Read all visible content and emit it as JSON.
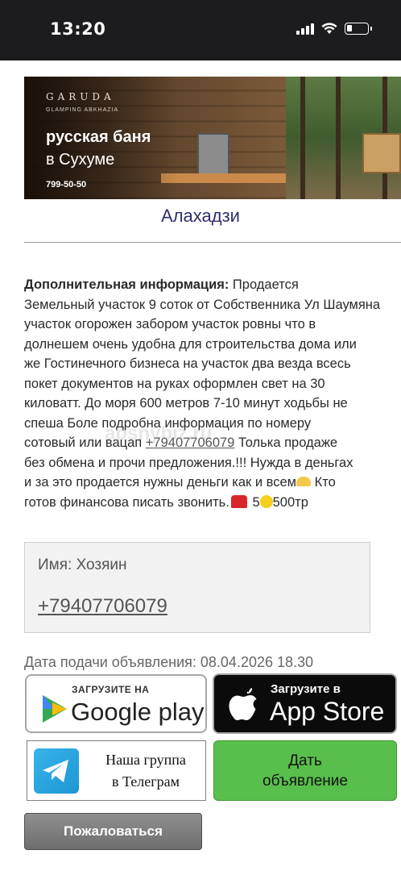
{
  "status_bar": {
    "time": "13:20"
  },
  "banner": {
    "logo": "GARUDA",
    "subtitle": "GLAMPING ABKHAZIA",
    "title_line1": "русская баня",
    "title_line2": "в Сухуме",
    "phone": "799-50-50"
  },
  "listing": {
    "city": "Алахадзи",
    "description_label": "Дополнительная информация:",
    "description_part1": " Продается\nЗемельный участок 9 соток от Собственника Ул Шаумяна\nучасток огорожен забором  участок ровны что в\nдолнешем  очень удобна для строительства дома или\nже  Гостинечного бизнеса на участок два везда всесь\nпокет документов на руках оформлен свет на 30\nкиловатт. До моря 600 метров 7-10 минут ходьбы не\nспеша Боле подробна  информация по номеру\nсотовый или вацап ",
    "description_phone": "+79407706079",
    "description_part2": "  Толька продаже\nбез обмена и прочи предложения.!!!  Нужда в деньгах\nи за это продается  нужны деньги как и всем",
    "description_part3": " Кто\nготов финансова писать звонить.",
    "description_price_a": " 5",
    "description_price_b": "500тр",
    "watermark": "apsnybiz.ru"
  },
  "contact": {
    "name": "Имя: Хозяин",
    "phone": "+79407706079"
  },
  "date": "Дата подачи объявления: 08.04.2026 18.30",
  "stores": {
    "google_small": "ЗАГРУЗИТЕ НА",
    "google_big": "Google play",
    "apple_small": "Загрузите в",
    "apple_big": "App Store"
  },
  "telegram": {
    "line1": "Наша группа",
    "line2": "в Телеграм"
  },
  "add_button": {
    "line1": "Дать",
    "line2": "объявление"
  },
  "complain_button": "Пожаловаться",
  "colors": {
    "accent_green": "#59bf4c",
    "city_color": "#2f2f6e",
    "telegram_blue": "#1e96d4"
  }
}
